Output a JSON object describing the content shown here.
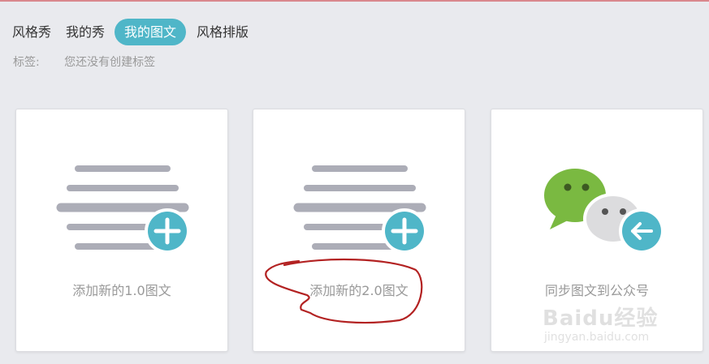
{
  "tabs": [
    {
      "label": "风格秀",
      "active": false
    },
    {
      "label": "我的秀",
      "active": false
    },
    {
      "label": "我的图文",
      "active": true
    },
    {
      "label": "风格排版",
      "active": false
    }
  ],
  "tags": {
    "label": "标签:",
    "value": "您还没有创建标签"
  },
  "cards": [
    {
      "label": "添加新的1.0图文",
      "icon": "add-article-icon"
    },
    {
      "label": "添加新的2.0图文",
      "icon": "add-article-icon"
    },
    {
      "label": "同步图文到公众号",
      "icon": "wechat-sync-icon"
    }
  ],
  "watermark": {
    "brand": "Baidu经验",
    "url": "jingyan.baidu.com"
  },
  "colors": {
    "accent": "#4fb6c8",
    "background": "#e9eaee",
    "line_gray": "#acadb7",
    "wechat_green": "#7ab941",
    "annotation_red": "#b32222"
  }
}
